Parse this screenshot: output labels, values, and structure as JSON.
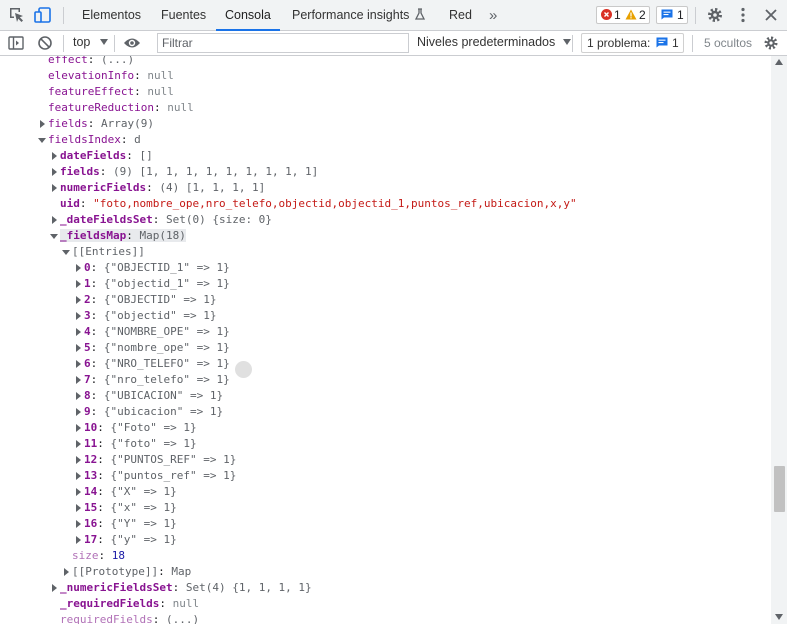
{
  "tabs": {
    "elements": "Elementos",
    "sources": "Fuentes",
    "console": "Consola",
    "performance": "Performance insights",
    "network": "Red",
    "more": "»"
  },
  "badges": {
    "errors": "1",
    "warnings": "2",
    "messages": "1"
  },
  "toolbar": {
    "context": "top",
    "filter_placeholder": "Filtrar",
    "levels": "Niveles predeterminados",
    "issues_label": "1 problema:",
    "issues_count": "1",
    "hidden": "5 ocultos"
  },
  "console": {
    "lines": [
      {
        "key": "effect",
        "sep": ": ",
        "value": "(...)",
        "style": "k",
        "vstyle": "g"
      },
      {
        "key": "elevationInfo",
        "sep": ": ",
        "value": "null",
        "style": "k",
        "vstyle": "n"
      },
      {
        "key": "featureEffect",
        "sep": ": ",
        "value": "null",
        "style": "k",
        "vstyle": "n"
      },
      {
        "key": "featureReduction",
        "sep": ": ",
        "value": "null",
        "style": "k",
        "vstyle": "n"
      },
      {
        "key": "fields",
        "sep": ": ",
        "value": "Array(9)",
        "style": "k",
        "vstyle": "g"
      },
      {
        "key": "fieldsIndex",
        "sep": ": ",
        "value": "d",
        "style": "k",
        "vstyle": "g"
      },
      {
        "key": "dateFields",
        "sep": ": ",
        "value": "[]",
        "style": "kb",
        "vstyle": "g"
      },
      {
        "key": "fields",
        "sep": ": ",
        "value": "(9) [1, 1, 1, 1, 1, 1, 1, 1, 1]",
        "style": "kb",
        "vstyle": "g"
      },
      {
        "key": "numericFields",
        "sep": ": ",
        "value": "(4) [1, 1, 1, 1]",
        "style": "kb",
        "vstyle": "g"
      },
      {
        "key": "uid",
        "sep": ": ",
        "value": "\"foto,nombre_ope,nro_telefo,objectid,objectid_1,puntos_ref,ubicacion,x,y\"",
        "style": "kb",
        "vstyle": "s"
      },
      {
        "key": "_dateFieldsSet",
        "sep": ": ",
        "value": "Set(0) {size: 0}",
        "style": "kb",
        "vstyle": "g"
      },
      {
        "key": "_fieldsMap",
        "sep": ": ",
        "value": "Map(18)",
        "style": "kb",
        "vstyle": "g"
      },
      {
        "key": "[[Entries]]",
        "sep": "",
        "value": "",
        "style": "g",
        "vstyle": "g"
      },
      {
        "key": "0",
        "sep": ": ",
        "value": "{\"OBJECTID_1\" => 1}",
        "style": "kb",
        "vstyle": "g"
      },
      {
        "key": "1",
        "sep": ": ",
        "value": "{\"objectid_1\" => 1}",
        "style": "kb",
        "vstyle": "g"
      },
      {
        "key": "2",
        "sep": ": ",
        "value": "{\"OBJECTID\" => 1}",
        "style": "kb",
        "vstyle": "g"
      },
      {
        "key": "3",
        "sep": ": ",
        "value": "{\"objectid\" => 1}",
        "style": "kb",
        "vstyle": "g"
      },
      {
        "key": "4",
        "sep": ": ",
        "value": "{\"NOMBRE_OPE\" => 1}",
        "style": "kb",
        "vstyle": "g"
      },
      {
        "key": "5",
        "sep": ": ",
        "value": "{\"nombre_ope\" => 1}",
        "style": "kb",
        "vstyle": "g"
      },
      {
        "key": "6",
        "sep": ": ",
        "value": "{\"NRO_TELEFO\" => 1}",
        "style": "kb",
        "vstyle": "g"
      },
      {
        "key": "7",
        "sep": ": ",
        "value": "{\"nro_telefo\" => 1}",
        "style": "kb",
        "vstyle": "g"
      },
      {
        "key": "8",
        "sep": ": ",
        "value": "{\"UBICACION\" => 1}",
        "style": "kb",
        "vstyle": "g"
      },
      {
        "key": "9",
        "sep": ": ",
        "value": "{\"ubicacion\" => 1}",
        "style": "kb",
        "vstyle": "g"
      },
      {
        "key": "10",
        "sep": ": ",
        "value": "{\"Foto\" => 1}",
        "style": "kb",
        "vstyle": "g"
      },
      {
        "key": "11",
        "sep": ": ",
        "value": "{\"foto\" => 1}",
        "style": "kb",
        "vstyle": "g"
      },
      {
        "key": "12",
        "sep": ": ",
        "value": "{\"PUNTOS_REF\" => 1}",
        "style": "kb",
        "vstyle": "g"
      },
      {
        "key": "13",
        "sep": ": ",
        "value": "{\"puntos_ref\" => 1}",
        "style": "kb",
        "vstyle": "g"
      },
      {
        "key": "14",
        "sep": ": ",
        "value": "{\"X\" => 1}",
        "style": "kb",
        "vstyle": "g"
      },
      {
        "key": "15",
        "sep": ": ",
        "value": "{\"x\" => 1}",
        "style": "kb",
        "vstyle": "g"
      },
      {
        "key": "16",
        "sep": ": ",
        "value": "{\"Y\" => 1}",
        "style": "kb",
        "vstyle": "g"
      },
      {
        "key": "17",
        "sep": ": ",
        "value": "{\"y\" => 1}",
        "style": "kb",
        "vstyle": "g"
      },
      {
        "key": "size",
        "sep": ": ",
        "value": "18",
        "style": "kd",
        "vstyle": "v"
      },
      {
        "key": "[[Prototype]]",
        "sep": ": ",
        "value": "Map",
        "style": "g",
        "vstyle": "g"
      },
      {
        "key": "_numericFieldsSet",
        "sep": ": ",
        "value": "Set(4) {1, 1, 1, 1}",
        "style": "kb",
        "vstyle": "g"
      },
      {
        "key": "_requiredFields",
        "sep": ": ",
        "value": "null",
        "style": "kb",
        "vstyle": "n"
      },
      {
        "key": "requiredFields",
        "sep": ": ",
        "value": "(...)",
        "style": "kd",
        "vstyle": "g"
      }
    ]
  }
}
